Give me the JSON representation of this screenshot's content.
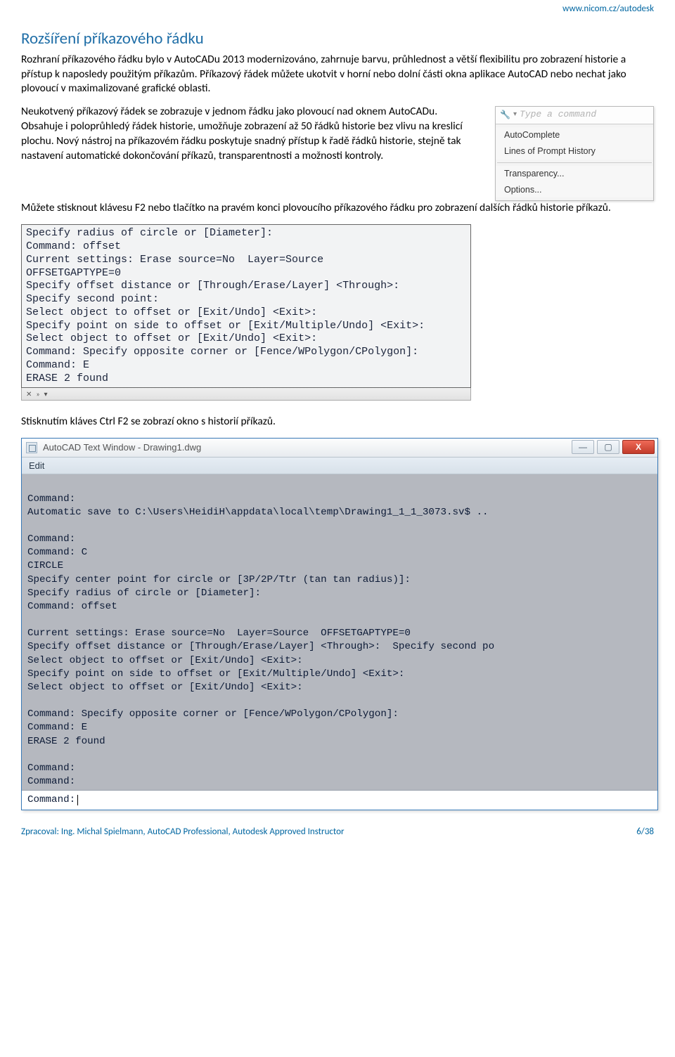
{
  "header_url": "www.nicom.cz/autodesk",
  "heading": "Rozšíření příkazového řádku",
  "para1": "Rozhraní příkazového řádku bylo v AutoCADu 2013 modernizováno, zahrnuje barvu, průhlednost a větší flexibilitu pro zobrazení historie a přístup k naposledy použitým příkazům. Příkazový řádek můžete ukotvit v horní nebo dolní části okna aplikace AutoCAD nebo nechat jako plovoucí v maximalizované grafické oblasti.",
  "para2": "Neukotvený příkazový řádek se zobrazuje v jednom řádku jako plovoucí nad oknem AutoCADu. Obsahuje i poloprůhledý řádek historie, umožňuje zobrazení až 50 řádků historie bez vlivu na kreslicí plochu. Nový nástroj na příkazovém řádku poskytuje snadný přístup k řadě řádků historie, stejně tak nastavení automatické dokončování příkazů, transparentnosti a možnosti kontroly.",
  "context_menu": {
    "placeholder": "Type a command",
    "items_top": [
      "AutoComplete",
      "Lines of Prompt History"
    ],
    "items_bottom": [
      "Transparency...",
      "Options..."
    ]
  },
  "para3": "Můžete stisknout klávesu F2 nebo tlačítko na pravém konci plovoucího příkazového řádku pro zobrazení dalších řádků historie příkazů.",
  "history_lines": [
    "Specify radius of circle or [Diameter]:",
    "Command: offset",
    "Current settings: Erase source=No  Layer=Source",
    "OFFSETGAPTYPE=0",
    "Specify offset distance or [Through/Erase/Layer] <Through>:",
    "Specify second point:",
    "Select object to offset or [Exit/Undo] <Exit>:",
    "Specify point on side to offset or [Exit/Multiple/Undo] <Exit>:",
    "Select object to offset or [Exit/Undo] <Exit>:",
    "Command: Specify opposite corner or [Fence/WPolygon/CPolygon]:",
    "Command: E",
    "ERASE 2 found"
  ],
  "para4": "Stisknutím kláves Ctrl F2 se zobrazí okno s historií příkazů.",
  "text_window": {
    "title": "AutoCAD Text Window - Drawing1.dwg",
    "menu": "Edit",
    "body_lines": [
      "",
      "Command:",
      "Automatic save to C:\\Users\\HeidiH\\appdata\\local\\temp\\Drawing1_1_1_3073.sv$ ..",
      "",
      "Command:",
      "Command: C",
      "CIRCLE",
      "Specify center point for circle or [3P/2P/Ttr (tan tan radius)]:",
      "Specify radius of circle or [Diameter]:",
      "Command: offset",
      "",
      "Current settings: Erase source=No  Layer=Source  OFFSETGAPTYPE=0",
      "Specify offset distance or [Through/Erase/Layer] <Through>:  Specify second po",
      "Select object to offset or [Exit/Undo] <Exit>:",
      "Specify point on side to offset or [Exit/Multiple/Undo] <Exit>:",
      "Select object to offset or [Exit/Undo] <Exit>:",
      "",
      "Command: Specify opposite corner or [Fence/WPolygon/CPolygon]:",
      "Command: E",
      "ERASE 2 found",
      "",
      "Command:",
      "Command:"
    ],
    "prompt": "Command: "
  },
  "footer_left": "Zpracoval: Ing. Michal Spielmann, AutoCAD Professional, Autodesk Approved Instructor",
  "footer_right": "6/38"
}
